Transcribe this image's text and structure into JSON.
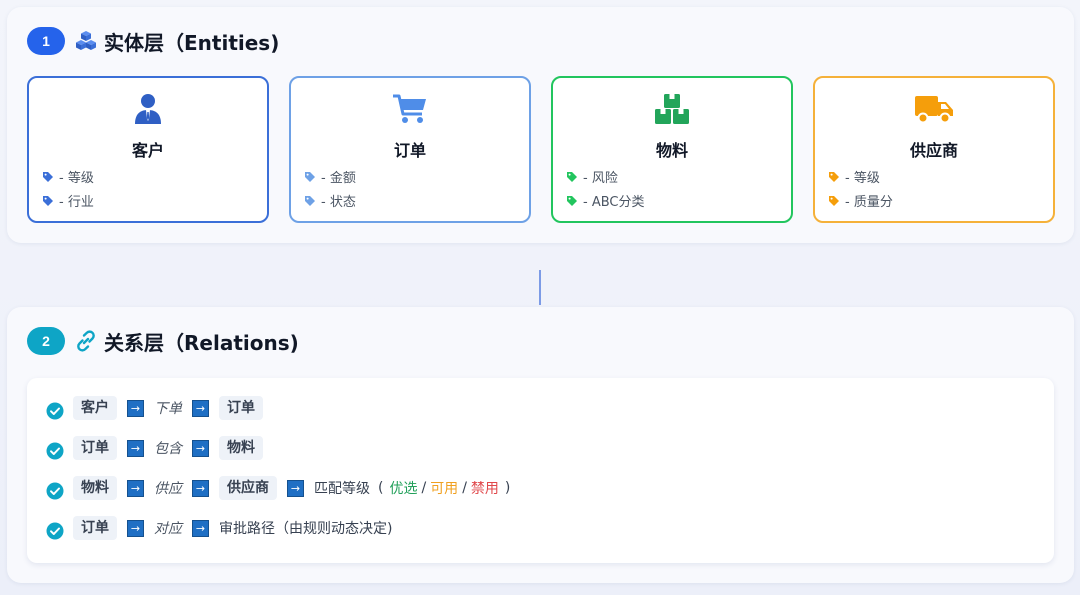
{
  "entities_layer": {
    "badge": "1",
    "title": "实体层（Entities)",
    "icon": "cubes-icon",
    "cards": [
      {
        "title": "客户",
        "icon": "user-icon",
        "color": "#3b6fd8",
        "attrs": [
          "- 等级",
          "- 行业"
        ]
      },
      {
        "title": "订单",
        "icon": "cart-icon",
        "color": "#6ea1e6",
        "attrs": [
          "- 金额",
          "- 状态"
        ]
      },
      {
        "title": "物料",
        "icon": "boxes-icon",
        "color": "#22c55e",
        "attrs": [
          "- 风险",
          "- ABC分类"
        ]
      },
      {
        "title": "供应商",
        "icon": "truck-icon",
        "color": "#f59e0b",
        "attrs": [
          "- 等级",
          "- 质量分"
        ]
      }
    ]
  },
  "relations_layer": {
    "badge": "2",
    "title": "关系层（Relations)",
    "icon": "link-icon",
    "rows": [
      {
        "from": "客户",
        "verb": "下单",
        "to": "订单"
      },
      {
        "from": "订单",
        "verb": "包含",
        "to": "物料"
      },
      {
        "from": "物料",
        "verb": "供应",
        "to": "供应商",
        "result": "匹配等级",
        "open": "(",
        "levels": [
          "优选",
          "可用",
          "禁用"
        ],
        "sep": "/",
        "close": ")"
      },
      {
        "from": "订单",
        "verb": "对应",
        "to": "审批路径（由规则动态决定)"
      }
    ],
    "arrow_glyph": "→"
  },
  "colors": {
    "primary_blue": "#2563eb",
    "teal": "#0ea5c6",
    "preferred": "#22a05a",
    "available": "#f0a020",
    "forbidden": "#e0484b"
  }
}
